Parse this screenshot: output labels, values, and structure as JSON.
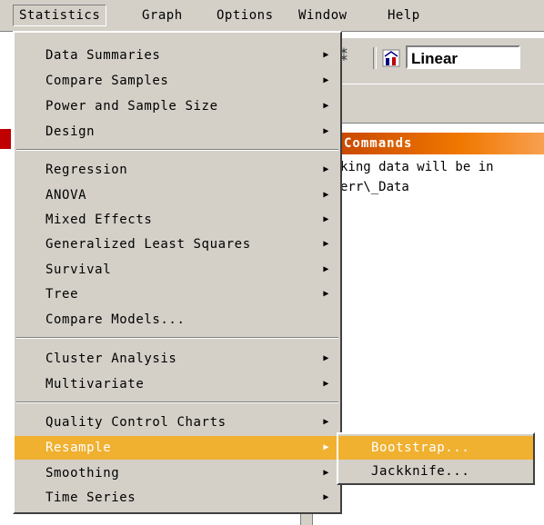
{
  "menubar": {
    "items": [
      "Statistics",
      "Graph",
      "Options",
      "Window",
      "Help"
    ]
  },
  "toolbar": {
    "combo_value": "Linear",
    "icons": [
      "tool-icon",
      "chart-type-icon"
    ]
  },
  "commands_panel": {
    "title": "Commands",
    "lines": [
      "king data will be in",
      "err\\_Data"
    ]
  },
  "statistics_menu": {
    "groups": [
      [
        {
          "label": "Data Summaries",
          "submenu": true
        },
        {
          "label": "Compare Samples",
          "submenu": true
        },
        {
          "label": "Power and Sample Size",
          "submenu": true
        },
        {
          "label": "Design",
          "submenu": true
        }
      ],
      [
        {
          "label": "Regression",
          "submenu": true
        },
        {
          "label": "ANOVA",
          "submenu": true
        },
        {
          "label": "Mixed Effects",
          "submenu": true
        },
        {
          "label": "Generalized Least Squares",
          "submenu": true
        },
        {
          "label": "Survival",
          "submenu": true
        },
        {
          "label": "Tree",
          "submenu": true
        },
        {
          "label": "Compare Models...",
          "submenu": false
        }
      ],
      [
        {
          "label": "Cluster Analysis",
          "submenu": true
        },
        {
          "label": "Multivariate",
          "submenu": true
        }
      ],
      [
        {
          "label": "Quality Control Charts",
          "submenu": true
        },
        {
          "label": "Resample",
          "submenu": true,
          "highlighted": true
        },
        {
          "label": "Smoothing",
          "submenu": true
        },
        {
          "label": "Time Series",
          "submenu": true
        }
      ]
    ]
  },
  "resample_submenu": {
    "items": [
      {
        "label": "Bootstrap...",
        "highlighted": true
      },
      {
        "label": "Jackknife...",
        "highlighted": false
      }
    ]
  },
  "colors": {
    "menu_bg": "#d4d0c8",
    "highlight": "#f0b030",
    "commands_header": "#f07800"
  }
}
